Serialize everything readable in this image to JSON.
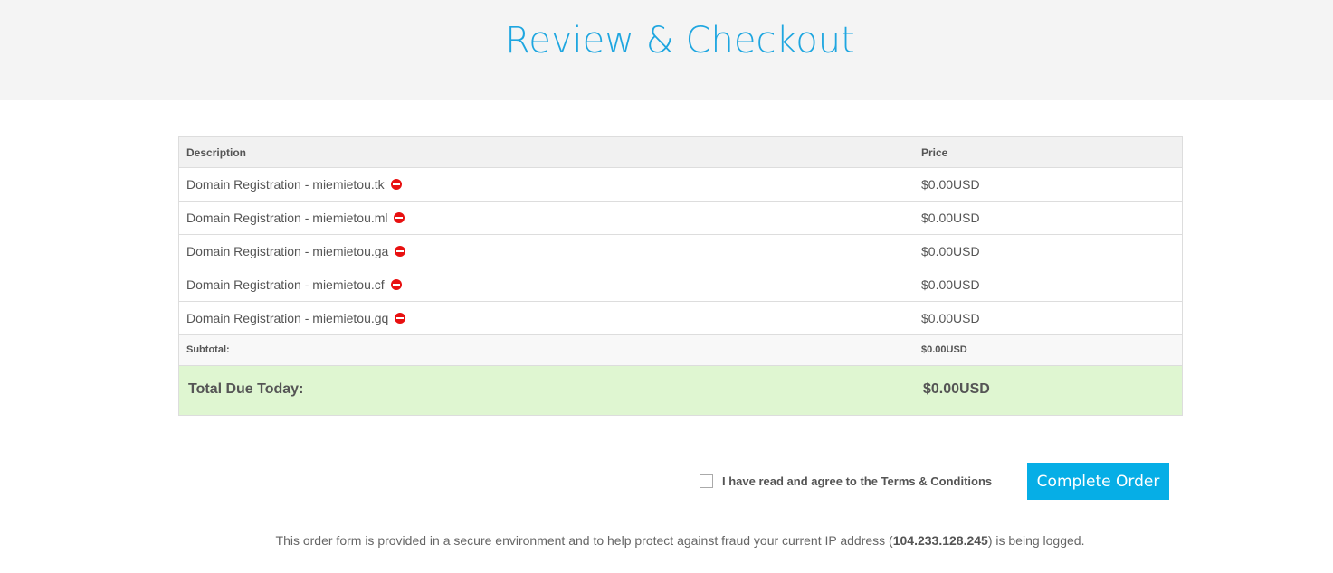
{
  "header": {
    "title": "Review & Checkout"
  },
  "table": {
    "col_description": "Description",
    "col_price": "Price",
    "items": [
      {
        "description": "Domain Registration - miemietou.tk",
        "price": "$0.00USD"
      },
      {
        "description": "Domain Registration - miemietou.ml",
        "price": "$0.00USD"
      },
      {
        "description": "Domain Registration - miemietou.ga",
        "price": "$0.00USD"
      },
      {
        "description": "Domain Registration - miemietou.cf",
        "price": "$0.00USD"
      },
      {
        "description": "Domain Registration - miemietou.gq",
        "price": "$0.00USD"
      }
    ],
    "subtotal_label": "Subtotal:",
    "subtotal_value": "$0.00USD",
    "total_label": "Total Due Today:",
    "total_value": "$0.00USD",
    "remove_icon": "remove-circle-icon"
  },
  "agreement": {
    "text": "I have read and agree to the",
    "terms_link": "Terms & Conditions",
    "checked": false
  },
  "complete_button": "Complete Order",
  "footer": {
    "note_before": "This order form is provided in a secure environment and to help protect against fraud your current IP address (",
    "ip": "104.233.128.245",
    "note_after": ") is being logged."
  },
  "colors": {
    "accent": "#1ea6e0",
    "button": "#06aee6",
    "total_row_bg": "#dff6d1",
    "remove_icon": "#e81010"
  }
}
